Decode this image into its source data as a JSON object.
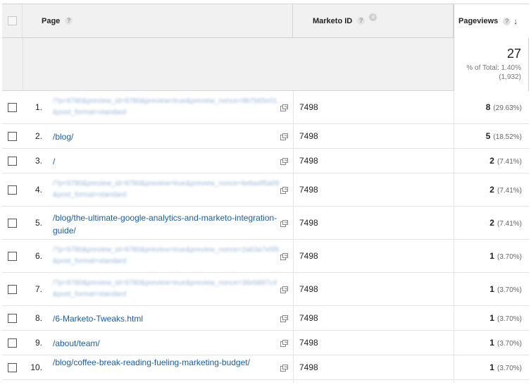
{
  "header": {
    "page_label": "Page",
    "dimension_label": "Marketo ID",
    "metric_label": "Pageviews",
    "help_glyph": "?",
    "remove_glyph": "×",
    "sort_glyph": "↓"
  },
  "totals": {
    "value": "27",
    "percent_line": "% of Total: 1.40%",
    "total_line": "(1,932)"
  },
  "rows": [
    {
      "idx": "1.",
      "page": "/?p=9780&preview_id=9780&preview=true&preview_nonce=9b7b65e01&post_format=standard",
      "obscured": true,
      "marketo_id": "7498",
      "pageviews": "8",
      "pct": "(29.63%)"
    },
    {
      "idx": "2.",
      "page": "/blog/",
      "obscured": false,
      "marketo_id": "7498",
      "pageviews": "5",
      "pct": "(18.52%)"
    },
    {
      "idx": "3.",
      "page": "/",
      "obscured": false,
      "marketo_id": "7498",
      "pageviews": "2",
      "pct": "(7.41%)"
    },
    {
      "idx": "4.",
      "page": "/?p=9780&preview_id=9780&preview=true&preview_nonce=beba4f5a09&post_format=standard",
      "obscured": true,
      "marketo_id": "7498",
      "pageviews": "2",
      "pct": "(7.41%)"
    },
    {
      "idx": "5.",
      "page": "/blog/the-ultimate-google-analytics-and-marketo-integration-guide/",
      "obscured": false,
      "marketo_id": "7498",
      "pageviews": "2",
      "pct": "(7.41%)"
    },
    {
      "idx": "6.",
      "page": "/?p=9780&preview_id=9780&preview=true&preview_nonce=2a63a7e5f6&post_format=standard",
      "obscured": true,
      "marketo_id": "7498",
      "pageviews": "1",
      "pct": "(3.70%)"
    },
    {
      "idx": "7.",
      "page": "/?p=9780&preview_id=9780&preview=true&preview_nonce=36eb887c4&post_format=standard",
      "obscured": true,
      "marketo_id": "7498",
      "pageviews": "1",
      "pct": "(3.70%)"
    },
    {
      "idx": "8.",
      "page": "/6-Marketo-Tweaks.html",
      "obscured": false,
      "marketo_id": "7498",
      "pageviews": "1",
      "pct": "(3.70%)"
    },
    {
      "idx": "9.",
      "page": "/about/team/",
      "obscured": false,
      "marketo_id": "7498",
      "pageviews": "1",
      "pct": "(3.70%)"
    },
    {
      "idx": "10.",
      "page": "/blog/coffee-break-reading-fueling-marketing-budget/",
      "obscured": false,
      "marketo_id": "7498",
      "pageviews": "1",
      "pct": "(3.70%)"
    }
  ]
}
